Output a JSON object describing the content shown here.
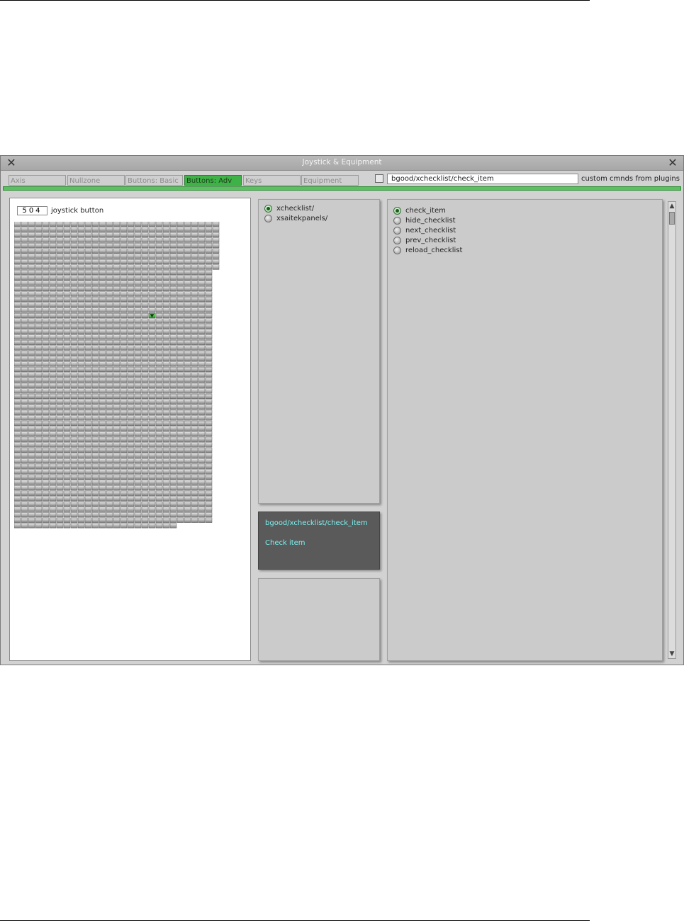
{
  "window": {
    "title": "Joystick & Equipment",
    "close_left": "✕",
    "close_right": "✕"
  },
  "tabs": [
    {
      "label": "Axis",
      "active": false
    },
    {
      "label": "Nullzone",
      "active": false
    },
    {
      "label": "Buttons: Basic",
      "active": false
    },
    {
      "label": "Buttons: Adv",
      "active": true
    },
    {
      "label": "Keys",
      "active": false
    },
    {
      "label": "Equipment",
      "active": false
    }
  ],
  "toolbar": {
    "command_value": "bgood/xchecklist/check_item",
    "custom_label": "custom cmnds from plugins"
  },
  "button_grid": {
    "button_number": "504",
    "button_label": "joystick button",
    "total_buttons": 1600,
    "selected_button": 504
  },
  "plugin_list": {
    "items": [
      {
        "label": "xchecklist/",
        "selected": true
      },
      {
        "label": "xsaitekpanels/",
        "selected": false
      }
    ]
  },
  "description": {
    "command": "bgood/xchecklist/check_item",
    "text": "Check item"
  },
  "command_list": {
    "items": [
      {
        "label": "check_item",
        "selected": true
      },
      {
        "label": "hide_checklist",
        "selected": false
      },
      {
        "label": "next_checklist",
        "selected": false
      },
      {
        "label": "prev_checklist",
        "selected": false
      },
      {
        "label": "reload_checklist",
        "selected": false
      }
    ]
  },
  "colors": {
    "accent_green": "#3fb247",
    "description_text": "#7df0f0",
    "description_bg": "#5a5a5a"
  }
}
